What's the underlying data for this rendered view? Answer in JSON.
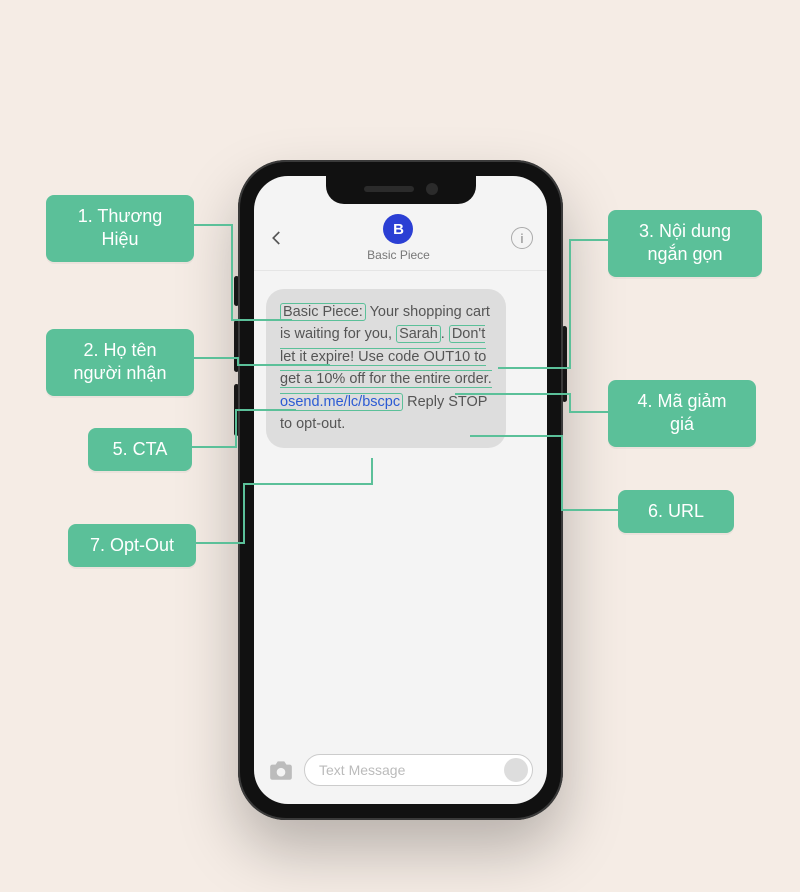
{
  "phone": {
    "contact_initial": "B",
    "contact_name": "Basic Piece",
    "input_placeholder": "Text Message"
  },
  "sms": {
    "brand": "Basic Piece:",
    "pre_name": " Your shopping cart is waiting for you, ",
    "name": "Sarah",
    "post_name": ". ",
    "body": "Don't let it expire! Use code ",
    "code": "OUT10",
    "after_code": " to get a 10% off for the entire order. ",
    "link": "osend.me/lc/bscpc",
    "optout": "Reply STOP to opt-out."
  },
  "callouts": {
    "c1": "1. Thương\nHiệu",
    "c2": "2. Họ tên\nngười nhận",
    "c3": "3. Nội dung\nngắn gọn",
    "c4": "4. Mã giảm\ngiá",
    "c5": "5. CTA",
    "c6": "6. URL",
    "c7": "7. Opt-Out"
  },
  "colors": {
    "accent": "#5bc099",
    "bg": "#f5ece5",
    "avatar": "#2b3fd4"
  }
}
